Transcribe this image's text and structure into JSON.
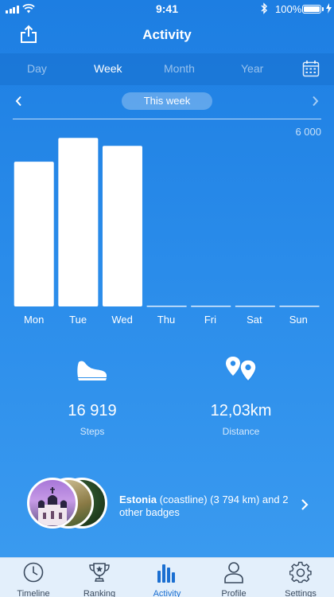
{
  "status_bar": {
    "time": "9:41",
    "battery_percent": "100%"
  },
  "header": {
    "title": "Activity"
  },
  "tabs": [
    {
      "label": "Day",
      "active": false
    },
    {
      "label": "Week",
      "active": true
    },
    {
      "label": "Month",
      "active": false
    },
    {
      "label": "Year",
      "active": false
    }
  ],
  "period": {
    "label": "This week"
  },
  "chart_data": {
    "type": "bar",
    "categories": [
      "Mon",
      "Tue",
      "Wed",
      "Thu",
      "Fri",
      "Sat",
      "Sun"
    ],
    "values": [
      5500,
      6400,
      6100,
      0,
      0,
      0,
      0
    ],
    "max_label": "6 000",
    "ylim": [
      0,
      6500
    ],
    "grid": false
  },
  "stats": {
    "steps": {
      "value": "16 919",
      "label": "Steps",
      "icon": "shoe-icon"
    },
    "distance": {
      "value": "12,03km",
      "label": "Distance",
      "icon": "map-pins-icon"
    }
  },
  "badges": {
    "name": "Estonia",
    "detail": " (coastline) (3 794 km) and 2 other badges"
  },
  "tabbar": [
    {
      "label": "Timeline",
      "icon": "clock-icon",
      "active": false
    },
    {
      "label": "Ranking",
      "icon": "trophy-icon",
      "active": false
    },
    {
      "label": "Activity",
      "icon": "bar-chart-icon",
      "active": true
    },
    {
      "label": "Profile",
      "icon": "person-icon",
      "active": false
    },
    {
      "label": "Settings",
      "icon": "gear-icon",
      "active": false
    }
  ],
  "colors": {
    "background": "#2a8cea",
    "tab_active": "#1b6fd1",
    "tabbar_bg": "#e3effb"
  }
}
